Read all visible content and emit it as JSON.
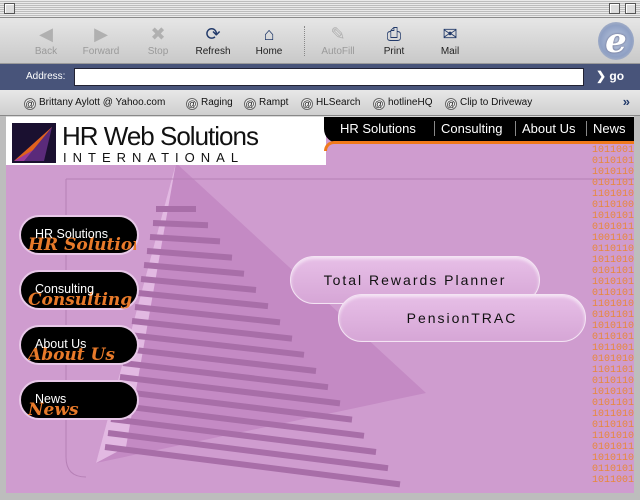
{
  "browser": {
    "toolbar": [
      {
        "label": "Back",
        "icon": "back-arrow-icon",
        "enabled": false
      },
      {
        "label": "Forward",
        "icon": "forward-arrow-icon",
        "enabled": false
      },
      {
        "label": "Stop",
        "icon": "stop-icon",
        "enabled": false
      },
      {
        "label": "Refresh",
        "icon": "refresh-icon",
        "enabled": true
      },
      {
        "label": "Home",
        "icon": "home-icon",
        "enabled": true
      },
      {
        "label": "AutoFill",
        "icon": "autofill-icon",
        "enabled": false
      },
      {
        "label": "Print",
        "icon": "printer-icon",
        "enabled": true
      },
      {
        "label": "Mail",
        "icon": "mail-icon",
        "enabled": true
      }
    ],
    "address_label": "Address:",
    "address_value": "",
    "go_label": "go",
    "favorites": [
      "Brittany Aylott @ Yahoo.com",
      "Raging",
      "Rampt",
      "HLSearch",
      "hotlineHQ",
      "Clip to Driveway"
    ],
    "logo": "e"
  },
  "site": {
    "title": "HR Web Solutions",
    "subtitle": "INTERNATIONAL",
    "topnav": [
      "HR Solutions",
      "Consulting",
      "About Us",
      "News"
    ],
    "side_buttons": [
      {
        "label": "HR Solutions",
        "ghost": "HR Solutions"
      },
      {
        "label": "Consulting",
        "ghost": "Consulting"
      },
      {
        "label": "About Us",
        "ghost": "About Us"
      },
      {
        "label": "News",
        "ghost": "News"
      }
    ],
    "pills": [
      "Total Rewards Planner",
      "PensionTRAC"
    ],
    "binary_text": "1011001\n0110101\n1010110\n0101101\n1101010\n0110100\n1010101\n0101011\n1001101\n0110110\n1011010\n0101101\n1010101\n0110101\n1101010\n0101101\n1010110\n0110101\n1011001\n0101010\n1101101\n0110110\n1010101\n0101101\n1011010\n0110101\n1101010\n0101011\n1010110\n0110101\n1011001",
    "colors": {
      "background": "#cf9ccf",
      "accent": "#f07a1c",
      "nav": "#000000"
    }
  }
}
